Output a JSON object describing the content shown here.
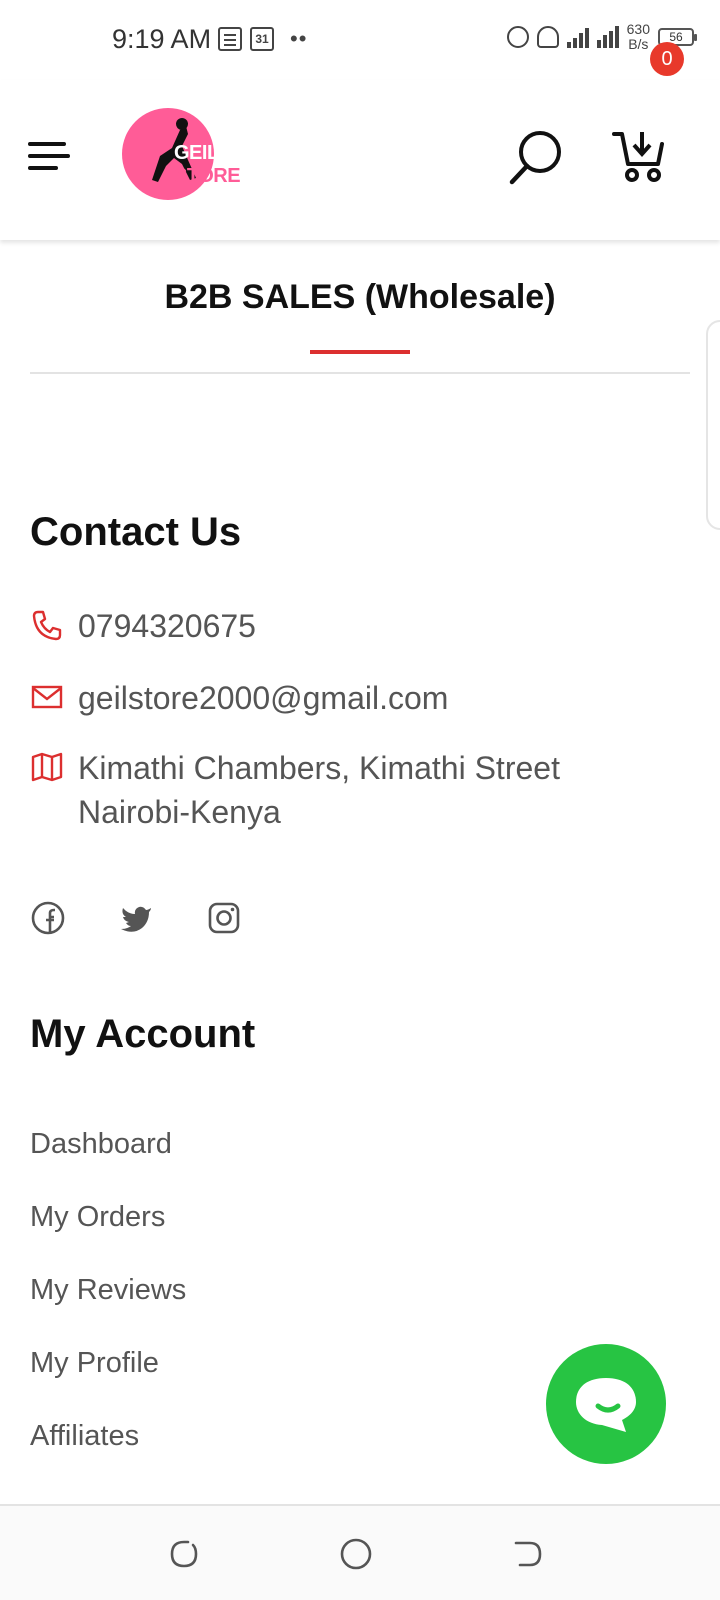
{
  "status_bar": {
    "time": "9:19 AM",
    "calendar_day": "31",
    "dots": "••",
    "network_speed_value": "630",
    "network_speed_unit": "B/s",
    "battery": "56",
    "icons": [
      "news-icon",
      "calendar-icon",
      "alarm-icon",
      "hotspot-icon",
      "signal-icon",
      "4g-signal-icon",
      "battery-icon"
    ]
  },
  "header": {
    "logo_text_a": "GEIL",
    "logo_text_b": "STORE",
    "cart_count": "0",
    "brand_color": "#ff5c97",
    "badge_color": "#e8392b"
  },
  "tab": {
    "title": "B2B SALES (Wholesale)",
    "accent_color": "#dc2f2f"
  },
  "contact": {
    "heading": "Contact Us",
    "phone": "0794320675",
    "email": "geilstore2000@gmail.com",
    "address": "Kimathi Chambers, Kimathi Street Nairobi-Kenya",
    "icon_color": "#dc2f2f"
  },
  "social": [
    "facebook-icon",
    "twitter-icon",
    "instagram-icon"
  ],
  "account": {
    "heading": "My Account",
    "links": [
      "Dashboard",
      "My Orders",
      "My Reviews",
      "My Profile",
      "Affiliates"
    ]
  },
  "chat": {
    "color": "#27c443"
  }
}
